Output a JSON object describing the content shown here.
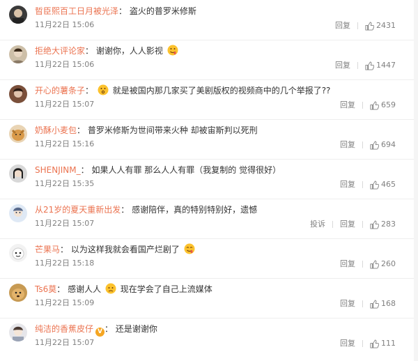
{
  "comments": [
    {
      "user": "晢臣熙百工日月被光泽",
      "colon": "：",
      "text": "盗火的普罗米修斯",
      "time": "11月22日 15:06",
      "actions": [],
      "reply": "回复",
      "likes": "2431",
      "emoji": "",
      "vip": false
    },
    {
      "user": "拒绝大评论家",
      "colon": "：",
      "text": "谢谢你，人人影视",
      "time": "11月22日 15:06",
      "actions": [],
      "reply": "回复",
      "likes": "1447",
      "emoji": "drool-emoji",
      "vip": false
    },
    {
      "user": "开心的薯条子",
      "colon": "：",
      "text": "就是被国内那几家买了美剧版权的视频商中的几个举报了??",
      "time": "11月22日 15:07",
      "actions": [],
      "reply": "回复",
      "likes": "659",
      "emoji": "think-emoji",
      "vip": false
    },
    {
      "user": "奶酥小麦包",
      "colon": "：",
      "text": "普罗米修斯为世间带来火种 却被宙斯判以死刑",
      "time": "11月22日 15:16",
      "actions": [],
      "reply": "回复",
      "likes": "694",
      "emoji": "",
      "vip": false
    },
    {
      "user": "SHENJINM_",
      "colon": "：",
      "text": "如果人人有罪 那么人人有罪（我复制的 觉得很好）",
      "time": "11月22日 15:35",
      "actions": [],
      "reply": "回复",
      "likes": "465",
      "emoji": "",
      "vip": false
    },
    {
      "user": "从21岁的夏天重新出发",
      "colon": "：",
      "text": "感谢陪伴，真的特别特别好，遗憾",
      "time": "11月22日 15:07",
      "actions": [
        "投诉"
      ],
      "reply": "回复",
      "likes": "283",
      "emoji": "",
      "vip": false
    },
    {
      "user": "芒果马",
      "colon": "：",
      "text": "以为这样我就会看国产烂剧了",
      "time": "11月22日 15:18",
      "actions": [],
      "reply": "回复",
      "likes": "260",
      "emoji": "drool-emoji",
      "vip": false
    },
    {
      "user": "Ts6莫",
      "colon": "：",
      "text": "感谢人人",
      "text2": "现在学会了自己上流媒体",
      "time": "11月22日 15:09",
      "actions": [],
      "reply": "回复",
      "likes": "168",
      "emoji": "sad-emoji",
      "vip": false
    },
    {
      "user": "纯洁的香蕉皮仔",
      "colon": "：",
      "text": "还是谢谢你",
      "time": "11月22日 15:07",
      "actions": [],
      "reply": "回复",
      "likes": "111",
      "emoji": "",
      "vip": true
    }
  ],
  "vip_badge": "V",
  "colors": {
    "username": "#eb7350",
    "meta": "#808080",
    "text": "#333333"
  }
}
